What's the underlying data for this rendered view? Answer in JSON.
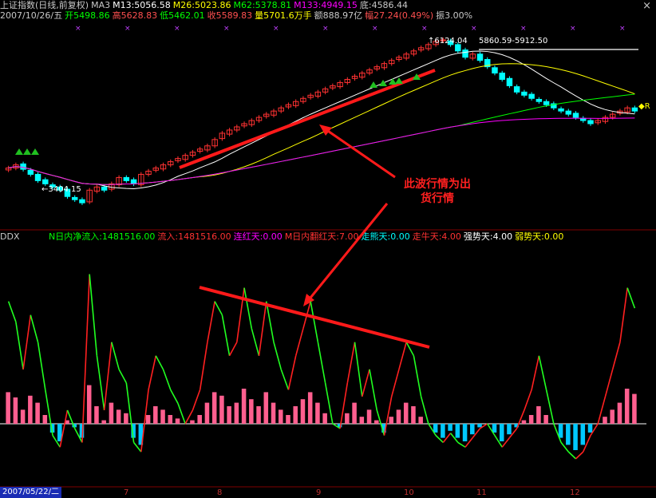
{
  "header": {
    "title": "上证指数(日线,前复权)",
    "ma_label": "MA3",
    "ma13": "M13:5056.58",
    "ma26": "M26:5023.86",
    "ma62": "M62:5378.81",
    "ma133": "M133:4949.15",
    "bottom": "底:4586.44",
    "date": "2007/10/26/五",
    "open": "开5498.86",
    "high": "高5628.83",
    "low": "低5462.01",
    "close": "收5589.83",
    "volume": "量5701.6万手",
    "amount": "额888.97亿",
    "change": "幅27.24(0.49%)",
    "amplitude": "振3.00%",
    "close_icon": "close-icon"
  },
  "price_panel": {
    "peak_label": "6124.04",
    "range_label": "5860.59-5912.50",
    "low_label": "3404.15",
    "r_label": "R"
  },
  "annotation": {
    "line1": "此波行情为出",
    "line2": "货行情"
  },
  "ddx": {
    "name": "DDX",
    "net_inflow": "N日内净流入:1481516.00",
    "inflow": "流入:1481516.00",
    "consecutive_red": "连红天:0.00",
    "n_day_red": "M日内翻红天:7.00",
    "walking_days": "走熊天:0.00",
    "bull_days": "走牛天:4.00",
    "strong_days": "强势天:4.00",
    "weak_days": "弱势天:0.00"
  },
  "footer": {
    "date": "2007/05/22/二",
    "months": [
      "7",
      "8",
      "9",
      "10",
      "11",
      "12"
    ]
  },
  "colors": {
    "up": "#ff3232",
    "down": "#00ffff",
    "ma13": "#ffffff",
    "ma26": "#ffff00",
    "ma62": "#00ff00",
    "ma133": "#ff00ff",
    "bar_pos": "#ff5f8f",
    "bar_neg": "#00c8ff",
    "accent_red": "#ff1a1a"
  },
  "chart_data": [
    {
      "type": "candlestick",
      "title": "上证指数(日线,前复权)",
      "period": "2007/05/22 - 2007/12",
      "x_months": [
        "7",
        "8",
        "9",
        "10",
        "11",
        "12"
      ],
      "close": [
        4100,
        4150,
        4080,
        4000,
        3900,
        3850,
        3800,
        3750,
        3650,
        3600,
        3550,
        3750,
        3800,
        3750,
        3850,
        3950,
        3900,
        3850,
        4000,
        4050,
        4100,
        4150,
        4200,
        4250,
        4300,
        4350,
        4400,
        4450,
        4550,
        4650,
        4700,
        4750,
        4800,
        4850,
        4900,
        4950,
        5000,
        5050,
        5100,
        5150,
        5200,
        5250,
        5300,
        5350,
        5400,
        5450,
        5500,
        5550,
        5600,
        5650,
        5700,
        5750,
        5800,
        5850,
        5900,
        5950,
        6000,
        6050,
        6100,
        6124,
        6050,
        5950,
        5850,
        5900,
        5800,
        5700,
        5600,
        5500,
        5400,
        5300,
        5250,
        5200,
        5150,
        5100,
        5050,
        5000,
        4950,
        4900,
        4850,
        4800,
        4850,
        4900,
        4950,
        5000,
        5050,
        5000
      ],
      "annotations": {
        "peak": "6124.04",
        "range": "5860.59-5912.50",
        "low": "3404.15"
      },
      "moving_averages": [
        "M13",
        "M26",
        "M62",
        "M133"
      ]
    },
    {
      "type": "line",
      "title": "DDX",
      "series": [
        {
          "name": "DDX",
          "values": [
            0.18,
            0.15,
            0.08,
            0.16,
            0.12,
            0.05,
            -0.05,
            -0.1,
            0.02,
            -0.02,
            -0.08,
            0.22,
            0.1,
            0.02,
            0.12,
            0.08,
            0.06,
            -0.08,
            -0.12,
            0.05,
            0.1,
            0.08,
            0.05,
            0.03,
            0.0,
            0.02,
            0.05,
            0.12,
            0.18,
            0.16,
            0.1,
            0.12,
            0.2,
            0.14,
            0.1,
            0.18,
            0.12,
            0.08,
            0.05,
            0.1,
            0.14,
            0.18,
            0.12,
            0.06,
            0.0,
            -0.02,
            0.06,
            0.12,
            0.04,
            0.08,
            0.02,
            -0.05,
            0.04,
            0.08,
            0.12,
            0.1,
            0.04,
            0.0,
            -0.05,
            -0.08,
            -0.04,
            -0.08,
            -0.1,
            -0.06,
            -0.02,
            0.0,
            -0.05,
            -0.1,
            -0.06,
            -0.02,
            0.02,
            0.05,
            0.1,
            0.05,
            0.0,
            -0.08,
            -0.12,
            -0.15,
            -0.12,
            -0.05,
            0.0,
            0.04,
            0.08,
            0.12,
            0.2,
            0.17
          ]
        }
      ],
      "ylim": [
        -0.35,
        0.4
      ]
    }
  ]
}
